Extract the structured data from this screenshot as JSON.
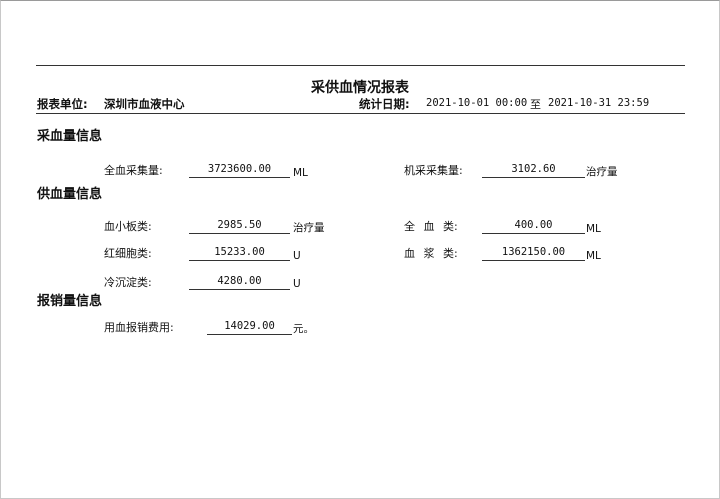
{
  "report": {
    "title": "采供血情况报表",
    "unit_label": "报表单位:",
    "unit_value": "深圳市血液中心",
    "date_label": "统计日期:",
    "date_from": "2021-10-01 00:00",
    "date_sep": "至",
    "date_to": "2021-10-31 23:59"
  },
  "collection": {
    "heading": "采血量信息",
    "whole_blood_label": "全血采集量:",
    "whole_blood_value": "3723600.00",
    "whole_blood_unit": "ML",
    "apheresis_label": "机采采集量:",
    "apheresis_value": "3102.60",
    "apheresis_unit": "治疗量"
  },
  "supply": {
    "heading": "供血量信息",
    "platelet_label": "血小板类:",
    "platelet_value": "2985.50",
    "platelet_unit": "治疗量",
    "whole_label": "全 血 类:",
    "whole_value": "400.00",
    "whole_unit": "ML",
    "rbc_label": "红细胞类:",
    "rbc_value": "15233.00",
    "rbc_unit": "U",
    "plasma_label": "血 浆 类:",
    "plasma_value": "1362150.00",
    "plasma_unit": "ML",
    "cryo_label": "冷沉淀类:",
    "cryo_value": "4280.00",
    "cryo_unit": "U"
  },
  "reimbursement": {
    "heading": "报销量信息",
    "fee_label": "用血报销费用:",
    "fee_value": "14029.00",
    "fee_unit": "元。"
  }
}
